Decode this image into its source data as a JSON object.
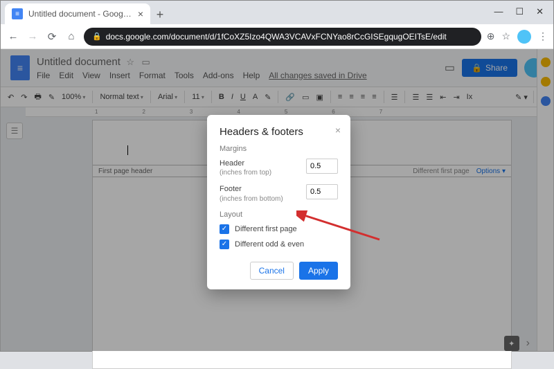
{
  "browser": {
    "tab_title": "Untitled document - Google Docs",
    "url": "docs.google.com/document/d/1fCoXZ5Izo4QWA3VCAVxFCNYao8rCcGISEgqugOEITsE/edit"
  },
  "doc": {
    "title": "Untitled document",
    "menus": [
      "File",
      "Edit",
      "View",
      "Insert",
      "Format",
      "Tools",
      "Add-ons",
      "Help"
    ],
    "save_status": "All changes saved in Drive",
    "share": "Share"
  },
  "toolbar": {
    "zoom": "100%",
    "style": "Normal text",
    "font": "Arial",
    "size": "11"
  },
  "ruler_marks": [
    "1",
    "2",
    "3",
    "4",
    "5",
    "6",
    "7"
  ],
  "header_strip": {
    "left": "First page header",
    "diff": "Different first page",
    "options": "Options"
  },
  "dialog": {
    "title": "Headers & footers",
    "margins_label": "Margins",
    "header_label": "Header",
    "header_sub": "(inches from top)",
    "header_value": "0.5",
    "footer_label": "Footer",
    "footer_sub": "(inches from bottom)",
    "footer_value": "0.5",
    "layout_label": "Layout",
    "diff_first": "Different first page",
    "diff_odd_even": "Different odd & even",
    "cancel": "Cancel",
    "apply": "Apply"
  }
}
